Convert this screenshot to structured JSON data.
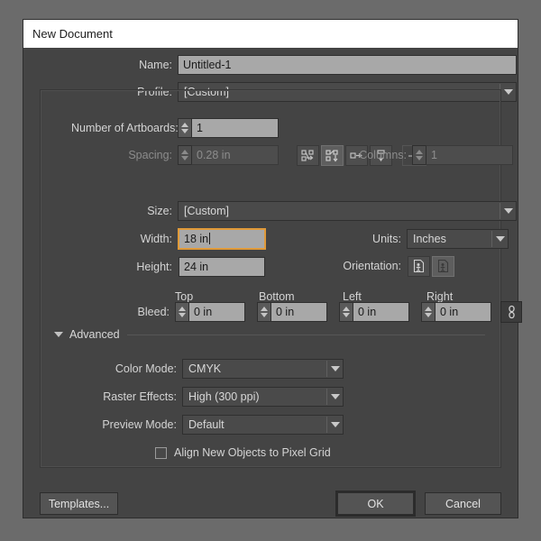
{
  "dialog": {
    "title": "New Document"
  },
  "fields": {
    "name_label": "Name:",
    "name_value": "Untitled-1",
    "profile_label": "Profile:",
    "profile_value": "[Custom]",
    "artboards_label": "Number of Artboards:",
    "artboards_value": "1",
    "spacing_label": "Spacing:",
    "spacing_value": "0.28 in",
    "columns_label": "Columns:",
    "columns_value": "1",
    "size_label": "Size:",
    "size_value": "[Custom]",
    "width_label": "Width:",
    "width_value": "18 in",
    "units_label": "Units:",
    "units_value": "Inches",
    "height_label": "Height:",
    "height_value": "24 in",
    "orientation_label": "Orientation:"
  },
  "bleed": {
    "label": "Bleed:",
    "top_label": "Top",
    "bottom_label": "Bottom",
    "left_label": "Left",
    "right_label": "Right",
    "top_value": "0 in",
    "bottom_value": "0 in",
    "left_value": "0 in",
    "right_value": "0 in",
    "link_icon": "link-chain-icon"
  },
  "advanced": {
    "section_label": "Advanced",
    "color_mode_label": "Color Mode:",
    "color_mode_value": "CMYK",
    "raster_label": "Raster Effects:",
    "raster_value": "High (300 ppi)",
    "preview_label": "Preview Mode:",
    "preview_value": "Default",
    "align_grid_label": "Align New Objects to Pixel Grid",
    "align_grid_checked": false
  },
  "buttons": {
    "templates": "Templates...",
    "ok": "OK",
    "cancel": "Cancel"
  },
  "icons": {
    "artboard_grid_row": "grid-by-row-icon",
    "artboard_grid_column": "grid-by-column-icon",
    "artboard_row": "arrange-by-row-icon",
    "artboard_column": "arrange-by-column-icon",
    "artboard_rtl": "right-to-left-layout-icon",
    "orientation_portrait": "portrait-icon",
    "orientation_landscape": "landscape-icon"
  },
  "colors": {
    "accent_focus": "#e09a3a",
    "dialog_bg": "#444444",
    "field_light": "#a8a8a8",
    "titlebar_bg": "#ffffff"
  }
}
